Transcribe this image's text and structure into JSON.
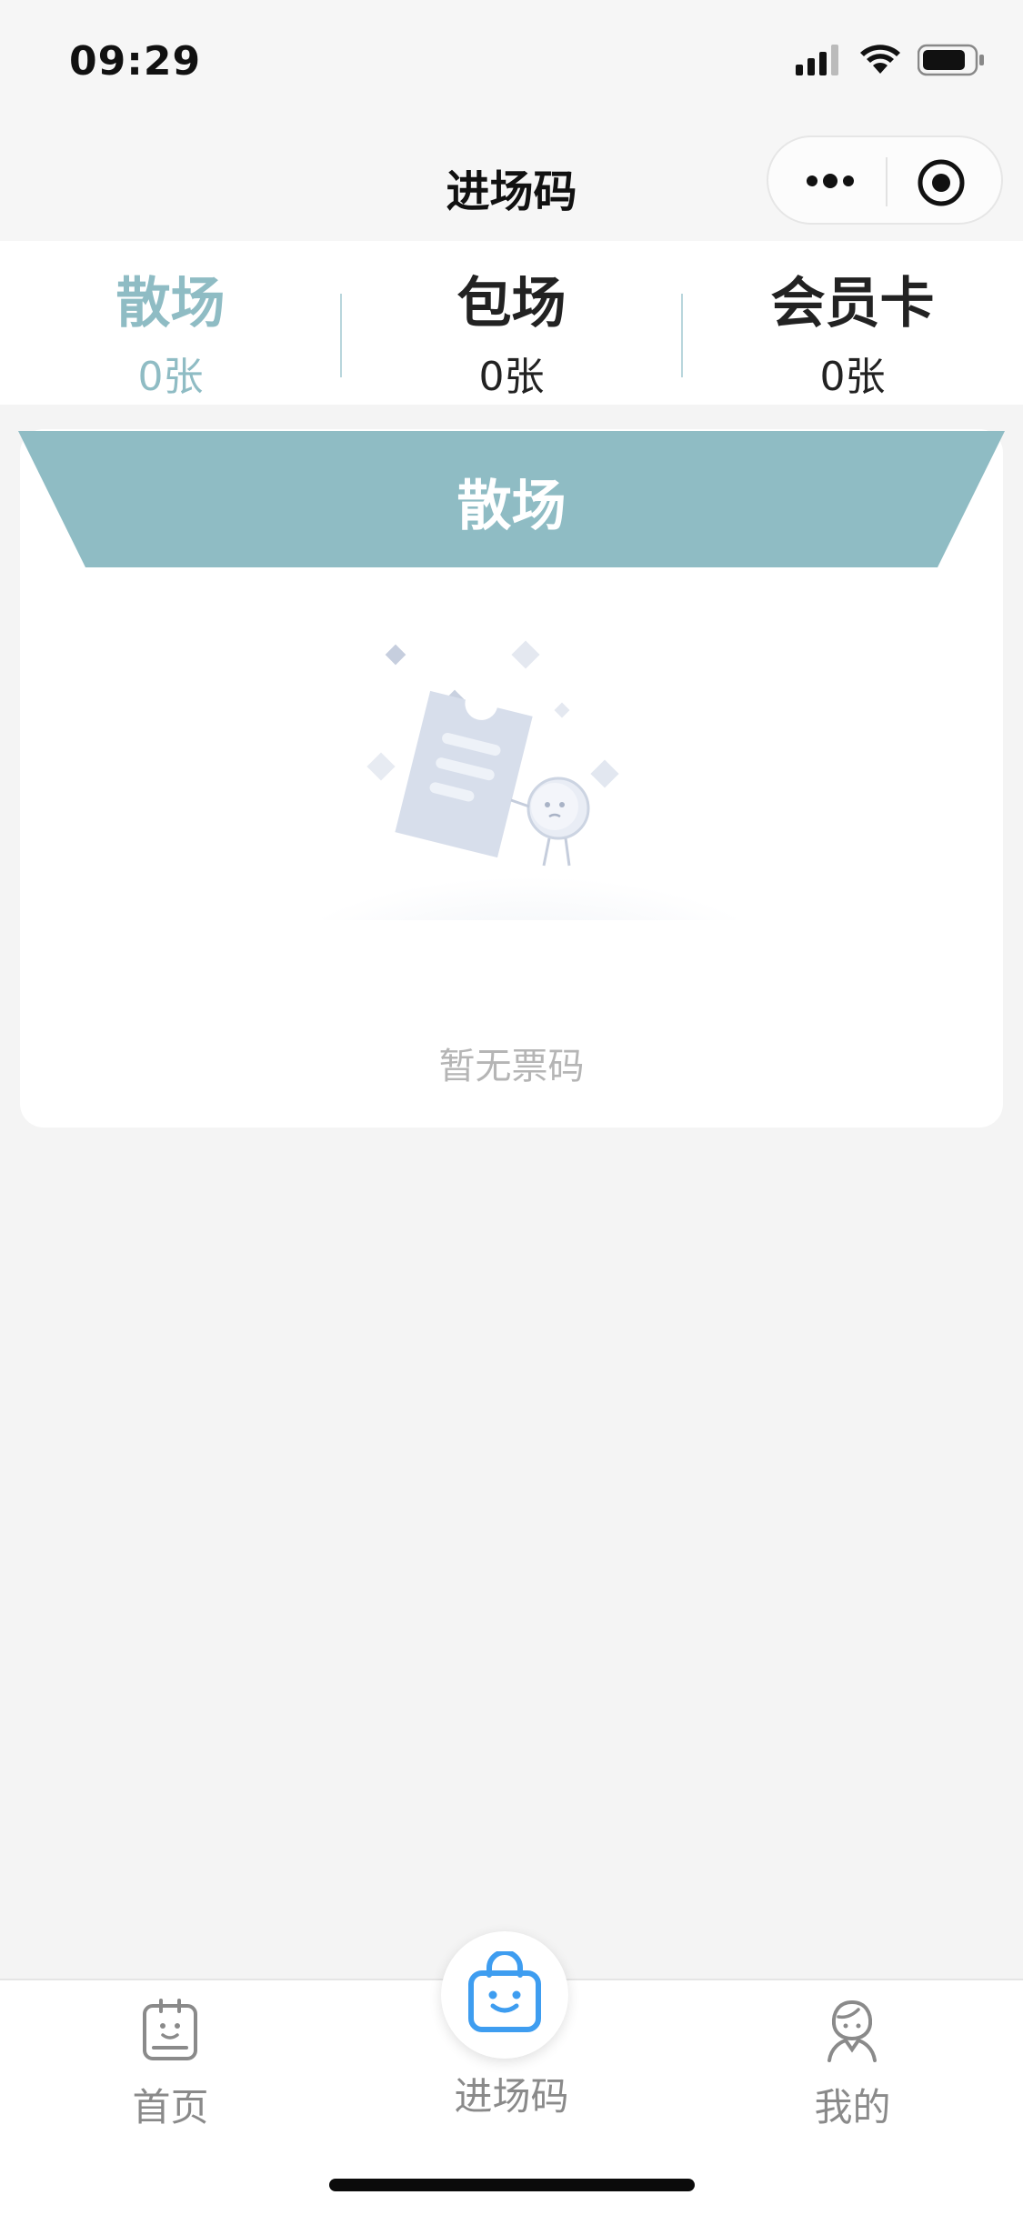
{
  "status_bar": {
    "time": "09:29"
  },
  "nav": {
    "title": "进场码"
  },
  "tabs": [
    {
      "label": "散场",
      "count": "0张",
      "active": true
    },
    {
      "label": "包场",
      "count": "0张",
      "active": false
    },
    {
      "label": "会员卡",
      "count": "0张",
      "active": false
    }
  ],
  "card": {
    "banner_title": "散场",
    "empty_text": "暂无票码"
  },
  "tabbar": {
    "items": [
      {
        "label": "首页",
        "icon": "home-note-icon"
      },
      {
        "label": "进场码",
        "icon": "shopping-bag-icon"
      },
      {
        "label": "我的",
        "icon": "user-icon"
      }
    ]
  },
  "colors": {
    "accent": "#8fbcc4",
    "bag_blue": "#3e9df0"
  }
}
